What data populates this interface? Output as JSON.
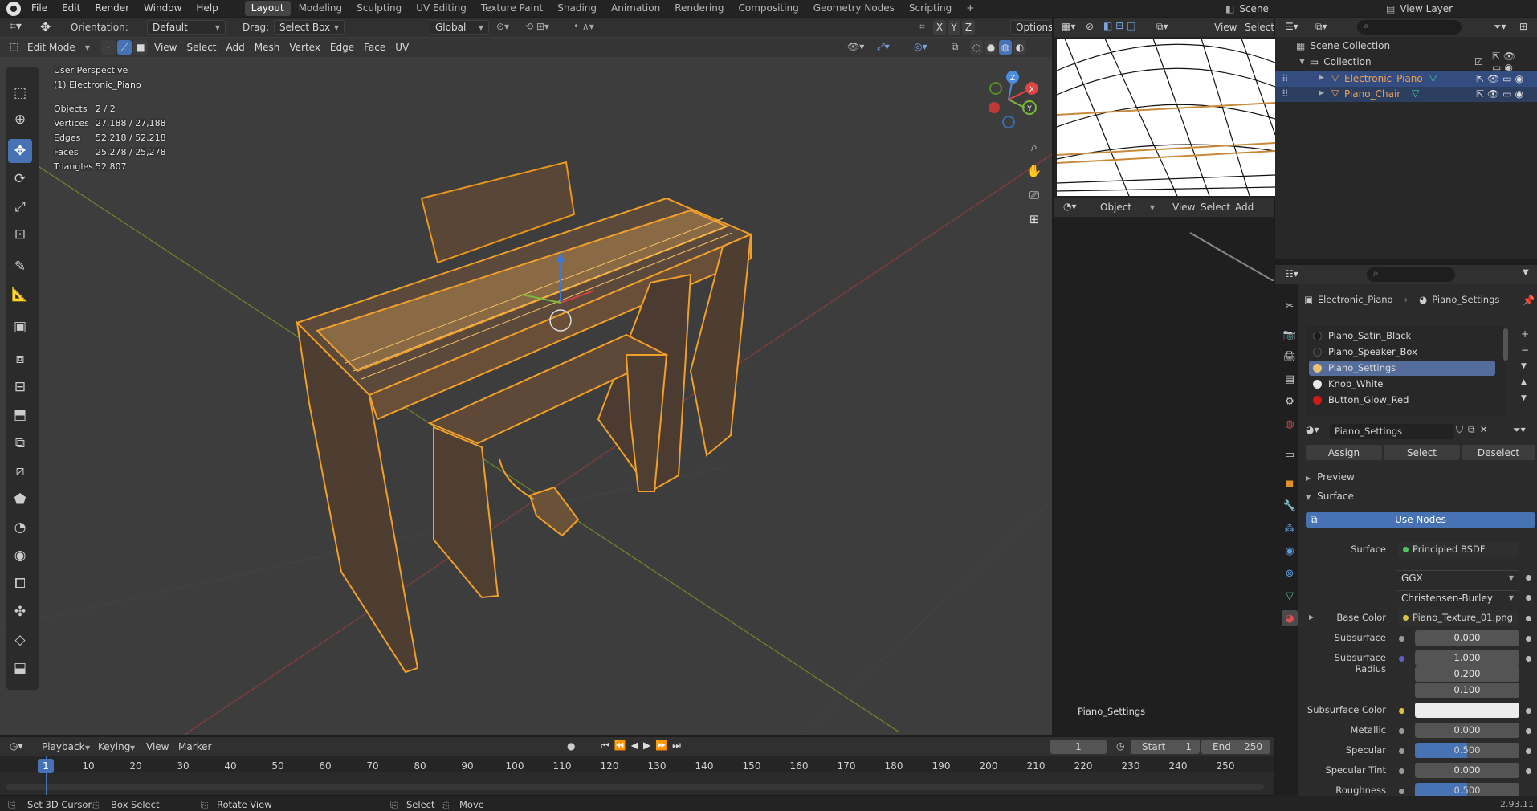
{
  "topbar": {
    "menus": [
      "File",
      "Edit",
      "Render",
      "Window",
      "Help"
    ],
    "workspaces": [
      "Layout",
      "Modeling",
      "Sculpting",
      "UV Editing",
      "Texture Paint",
      "Shading",
      "Animation",
      "Rendering",
      "Compositing",
      "Geometry Nodes",
      "Scripting"
    ],
    "active_workspace": "Layout",
    "add_tab": "+",
    "scene_label": "Scene",
    "view_layer_label": "View Layer"
  },
  "viewport_header": {
    "orientation_label": "Orientation:",
    "orientation_value": "Default",
    "drag_label": "Drag:",
    "drag_value": "Select Box",
    "transform_space": "Global",
    "axes": [
      "X",
      "Y",
      "Z"
    ],
    "options_label": "Options",
    "mode": "Edit Mode",
    "menus": [
      "View",
      "Select",
      "Add",
      "Mesh",
      "Vertex",
      "Edge",
      "Face",
      "UV"
    ]
  },
  "viewport_overlay": {
    "perspective": "User Perspective",
    "object": "(1) Electronic_Piano",
    "stats": [
      {
        "label": "Objects",
        "value": "2 / 2"
      },
      {
        "label": "Vertices",
        "value": "27,188 / 27,188"
      },
      {
        "label": "Edges",
        "value": "52,218 / 52,218"
      },
      {
        "label": "Faces",
        "value": "25,278 / 25,278"
      },
      {
        "label": "Triangles",
        "value": "52,807"
      }
    ],
    "gizmo_axes": {
      "x": "X",
      "y": "Y",
      "z": "Z"
    }
  },
  "node_header": {
    "object_mode": "Object",
    "menus": [
      "View",
      "Select",
      "Add"
    ],
    "node_label": "Piano_Settings",
    "top_menus": [
      "View",
      "Select"
    ]
  },
  "outliner": {
    "scene_collection": "Scene Collection",
    "collection": "Collection",
    "items": [
      {
        "name": "Electronic_Piano",
        "selected": true
      },
      {
        "name": "Piano_Chair",
        "selected": true
      }
    ]
  },
  "properties": {
    "breadcrumb_object": "Electronic_Piano",
    "breadcrumb_material": "Piano_Settings",
    "materials": [
      {
        "name": "Piano_Satin_Black",
        "color": "#1a1a1a"
      },
      {
        "name": "Piano_Speaker_Box",
        "color": "#2a2a2a"
      },
      {
        "name": "Piano_Settings",
        "color": "#e8c070",
        "active": true
      },
      {
        "name": "Knob_White",
        "color": "#e8e8e8"
      },
      {
        "name": "Button_Glow_Red",
        "color": "#d01a1a"
      }
    ],
    "material_name": "Piano_Settings",
    "assign_label": "Assign",
    "select_label": "Select",
    "deselect_label": "Deselect",
    "preview_label": "Preview",
    "surface_panel_label": "Surface",
    "use_nodes_label": "Use Nodes",
    "fields": {
      "surface_label": "Surface",
      "surface_value": "Principled BSDF",
      "distribution": "GGX",
      "subsurface_method": "Christensen-Burley",
      "base_color_label": "Base Color",
      "base_color_value": "Piano_Texture_01.png",
      "subsurface_label": "Subsurface",
      "subsurface_value": "0.000",
      "subsurface_radius_label": "Subsurface Radius",
      "subsurface_radius": [
        "1.000",
        "0.200",
        "0.100"
      ],
      "subsurface_color_label": "Subsurface Color",
      "metallic_label": "Metallic",
      "metallic_value": "0.000",
      "specular_label": "Specular",
      "specular_value": "0.500",
      "specular_tint_label": "Specular Tint",
      "specular_tint_value": "0.000",
      "roughness_label": "Roughness",
      "roughness_value": "0.500"
    },
    "accent_color": "#4772b3"
  },
  "timeline": {
    "menus": [
      "Playback",
      "Keying",
      "View",
      "Marker"
    ],
    "current_frame": "1",
    "start_label": "Start",
    "start_value": "1",
    "end_label": "End",
    "end_value": "250",
    "ticks": [
      "1",
      "10",
      "20",
      "30",
      "40",
      "50",
      "60",
      "70",
      "80",
      "90",
      "100",
      "110",
      "120",
      "130",
      "140",
      "150",
      "160",
      "170",
      "180",
      "190",
      "200",
      "210",
      "220",
      "230",
      "240",
      "250"
    ]
  },
  "statusbar": {
    "items": [
      "Set 3D Cursor",
      "Box Select",
      "Rotate View",
      "Select",
      "Move"
    ],
    "version": "2.93.11"
  }
}
